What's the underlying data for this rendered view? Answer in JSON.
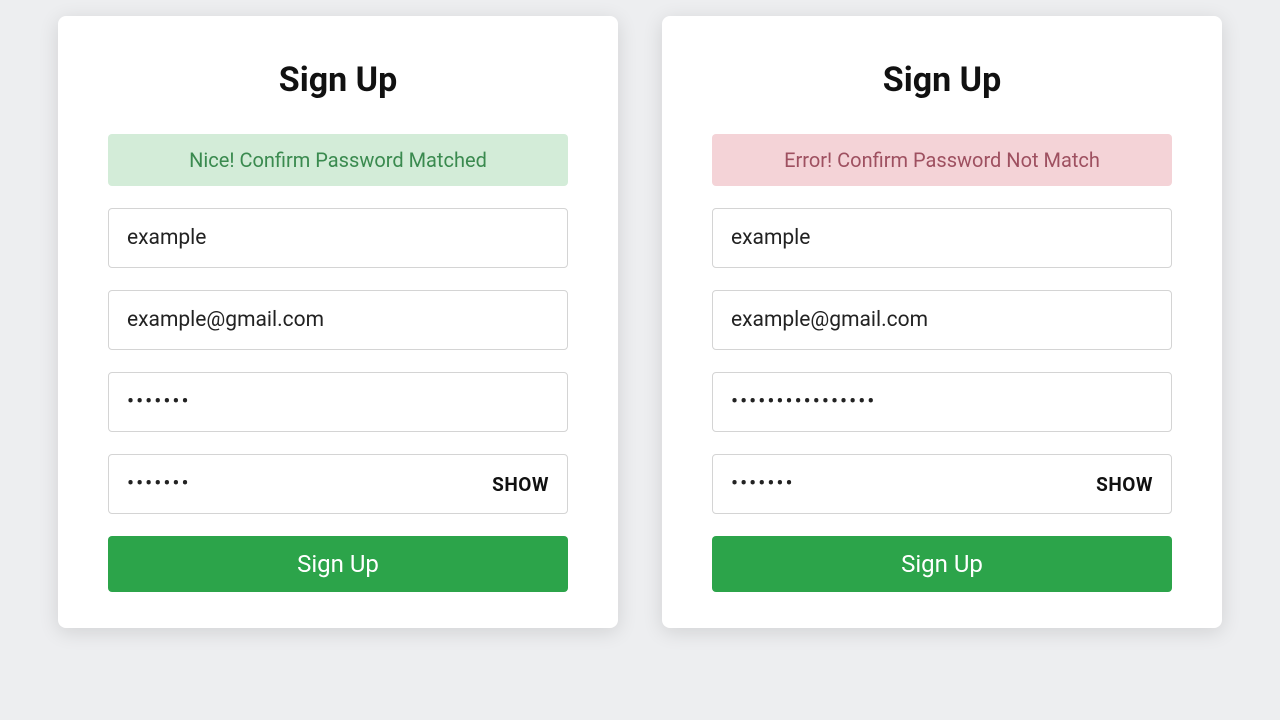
{
  "left": {
    "title": "Sign Up",
    "alert": "Nice! Confirm Password Matched",
    "alert_type": "success",
    "username": "example",
    "email": "example@gmail.com",
    "password": "•••••••",
    "confirm_password": "•••••••",
    "show_label": "SHOW",
    "submit_label": "Sign Up"
  },
  "right": {
    "title": "Sign Up",
    "alert": "Error! Confirm Password Not Match",
    "alert_type": "error",
    "username": "example",
    "email": "example@gmail.com",
    "password": "••••••••••••••••",
    "confirm_password": "•••••••",
    "show_label": "SHOW",
    "submit_label": "Sign Up"
  }
}
